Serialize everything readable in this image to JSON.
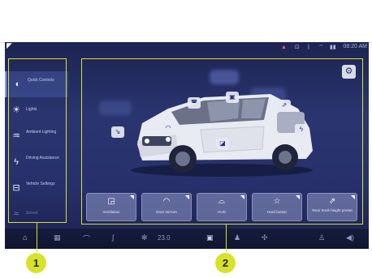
{
  "status": {
    "time": "08:20 AM",
    "icons": [
      "seatbelt-warning-icon",
      "lock-icon",
      "bluetooth-icon",
      "wifi-icon",
      "signal-icon"
    ]
  },
  "sidebar": {
    "items": [
      {
        "label": "Quick Controls",
        "icon": "quick-controls-icon",
        "active": true
      },
      {
        "label": "Lights",
        "icon": "sun-icon",
        "active": false
      },
      {
        "label": "Ambient Lighting",
        "icon": "ambient-light-icon",
        "active": false
      },
      {
        "label": "Driving Assistance",
        "icon": "steering-assist-icon",
        "active": false
      },
      {
        "label": "Vehicle Settings",
        "icon": "vehicle-settings-icon",
        "active": false
      },
      {
        "label": "Sound",
        "icon": "sound-icon",
        "active": false
      }
    ]
  },
  "quick_buttons": [
    {
      "label": "Ventilation",
      "icon": "window-ventilation-icon"
    },
    {
      "label": "Door mirrors",
      "icon": "mirror-icon"
    },
    {
      "label": "HUD",
      "icon": "hud-icon"
    },
    {
      "label": "Hard button",
      "icon": "star-icon"
    },
    {
      "label": "Rear trunk height preset",
      "icon": "trunk-height-icon"
    }
  ],
  "callouts": [
    {
      "number": "1"
    },
    {
      "number": "2"
    }
  ],
  "dock": {
    "temperature": "23.0",
    "icons": [
      "home-icon",
      "apps-icon",
      "climate-icon",
      "seat-heat-icon",
      "fan-icon",
      "defrost-icon",
      "seat-icon",
      "fan-speed-icon",
      "volume-icon"
    ]
  },
  "colors": {
    "callout": "#d8e22a",
    "screen_bg": "#27306a",
    "accent": "#7fa2ff"
  }
}
